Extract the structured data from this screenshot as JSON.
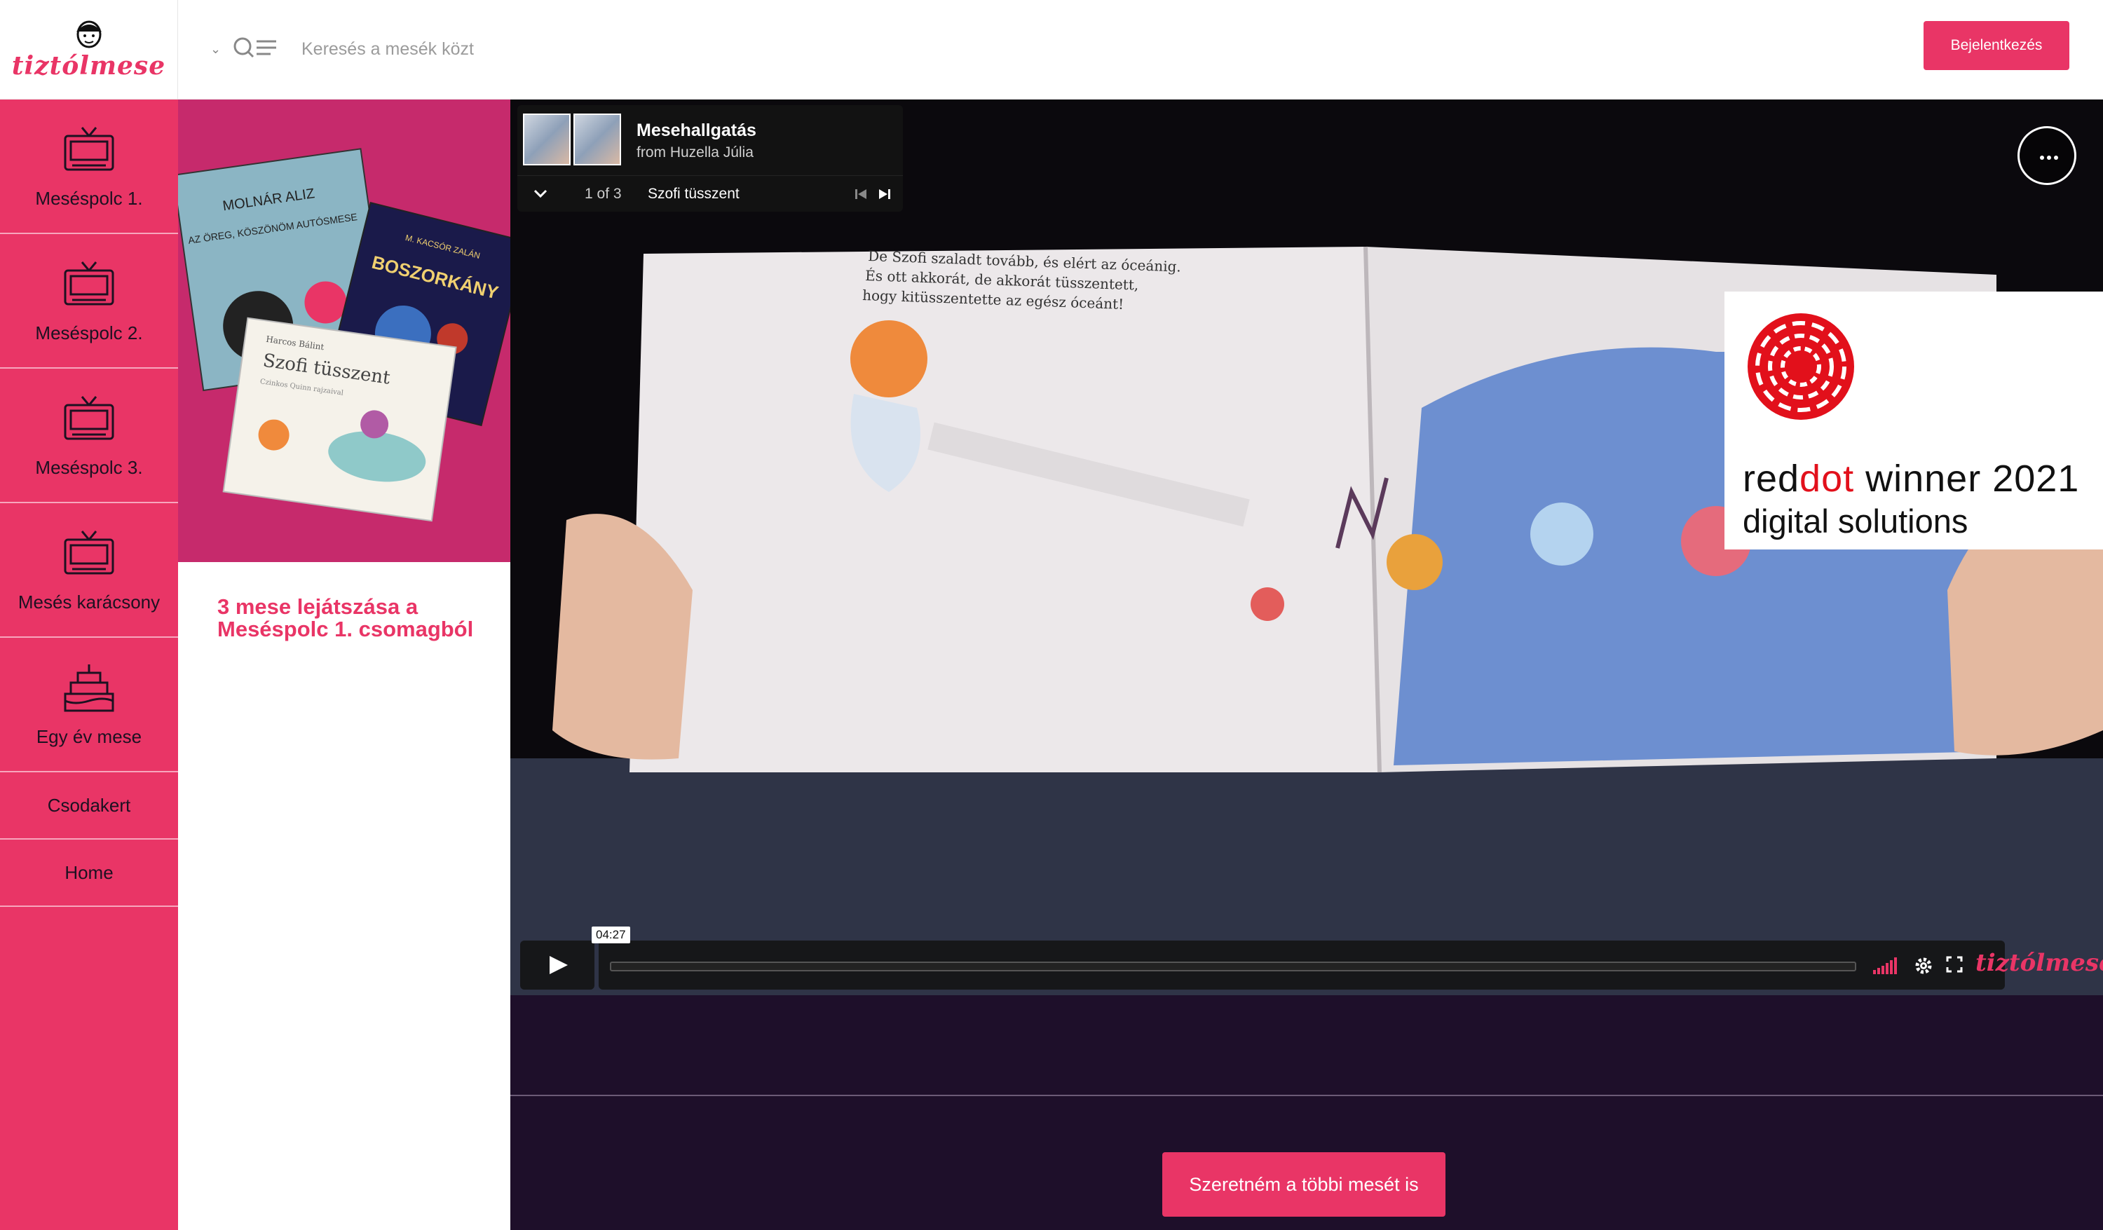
{
  "header": {
    "logo_text": "tiztólmese",
    "search_placeholder": "Keresés a mesék közt",
    "login_label": "Bejelentkezés"
  },
  "sidebar": {
    "items": [
      {
        "label": "Meséspolc 1.",
        "icon": "tv-icon"
      },
      {
        "label": "Meséspolc 2.",
        "icon": "tv-icon"
      },
      {
        "label": "Meséspolc 3.",
        "icon": "tv-icon"
      },
      {
        "label": "Mesés karácsony",
        "icon": "tv-icon"
      },
      {
        "label": "Egy év mese",
        "icon": "cake-icon"
      },
      {
        "label": "Csodakert"
      },
      {
        "label": "Home"
      }
    ]
  },
  "panel": {
    "title": "3 mese lejátszása a Meséspolc 1. csomagból",
    "books": [
      "MOLNÁR ALIZ",
      "AZ ÖREG, KÖSZÖNÖM AUTÓSMESE",
      "M. KACSÓR ZALÁN",
      "BOSZORKÁNY",
      "Harcos Bálint",
      "Szofi tüsszent",
      "Czinkos Quinn rajzaival"
    ]
  },
  "player": {
    "playlist_title": "Mesehallgatás",
    "playlist_from": "from Huzella Júlia",
    "playlist_position": "1 of 3",
    "current_track": "Szofi tüsszent",
    "time": "04:27",
    "progress": 0.0,
    "book_text": [
      "De Szofi szaladt tovább, és elért az óceánig.",
      "És ott akkorát, de akkorát tüsszentett,",
      "hogy kitüsszentette az egész óceánt!"
    ],
    "control_logo": "tiztólmese"
  },
  "badge": {
    "brand_red": "red",
    "brand_dot": "dot",
    "brand_rest": " winner 2021",
    "subtitle": "digital solutions"
  },
  "cta": {
    "label": "Szeretném a többi mesét is"
  },
  "colors": {
    "accent": "#e93566",
    "dark": "#1e0f2a"
  }
}
